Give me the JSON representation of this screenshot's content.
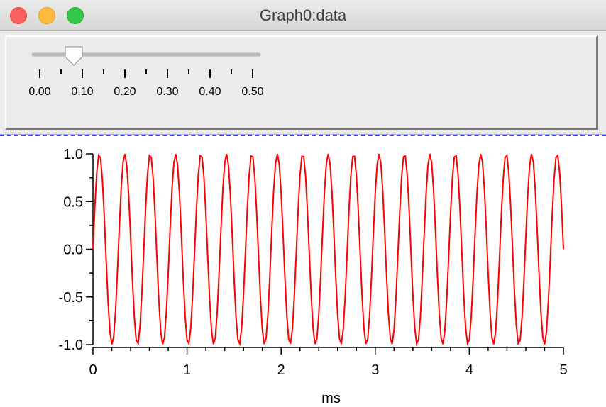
{
  "window": {
    "title": "Graph0:data"
  },
  "slider": {
    "value": 0.08,
    "min": 0.0,
    "max": 0.5,
    "tick_labels": [
      "0.00",
      "0.10",
      "0.20",
      "0.30",
      "0.40",
      "0.50"
    ]
  },
  "colors": {
    "trace": "#ff0000",
    "divider": "#3b3bff"
  },
  "chart_data": {
    "type": "line",
    "title": "",
    "xlabel": "ms",
    "ylabel": "",
    "xlim": [
      0,
      5
    ],
    "ylim": [
      -1.0,
      1.0
    ],
    "x_ticks": [
      "0",
      "1",
      "2",
      "3",
      "4",
      "5"
    ],
    "y_ticks": [
      "1.0",
      "0.5",
      "0.0",
      "-0.5",
      "-1.0"
    ],
    "grid": false,
    "series": [
      {
        "function": "sine",
        "amplitude": 1.0,
        "frequency_cycles_per_ms": 3.7,
        "phase": 0.0,
        "x_start": 0,
        "x_end": 5,
        "sample_interval_ms": 0.02
      }
    ]
  }
}
